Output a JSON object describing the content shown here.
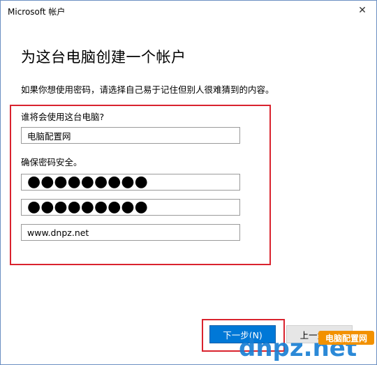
{
  "window": {
    "title": "Microsoft 帐户",
    "close_glyph": "✕"
  },
  "page": {
    "heading": "为这台电脑创建一个帐户",
    "instructions": "如果你想使用密码，请选择自己易于记住但别人很难猜到的内容。"
  },
  "form": {
    "username_label": "谁将会使用这台电脑?",
    "username_value": "电脑配置网",
    "password_label": "确保密码安全。",
    "password_value": "●●●●●●●●●",
    "confirm_password_value": "●●●●●●●●●",
    "hint_value": "www.dnpz.net"
  },
  "buttons": {
    "next_label": "下一步(N)",
    "back_label": "上一步(B)"
  },
  "watermark": {
    "logo_text": "dnpz.net",
    "badge_text": "电脑配置网"
  },
  "colors": {
    "accent": "#0078d7",
    "highlight": "#d9232e",
    "watermark_blue": "#1a7fd4",
    "watermark_orange": "#f29100"
  }
}
